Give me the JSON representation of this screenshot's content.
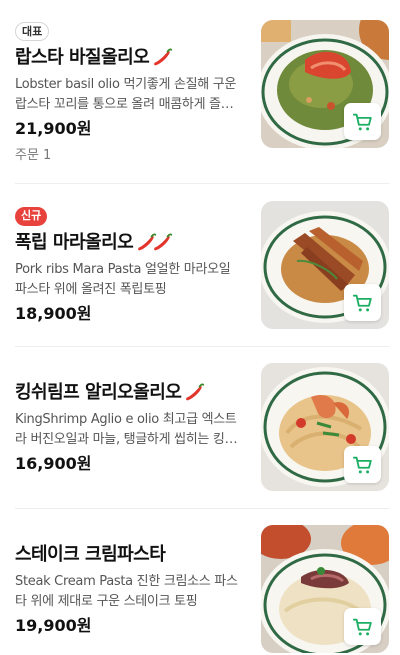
{
  "colors": {
    "accent_green": "#1cae62",
    "badge_red": "#e8423c",
    "text_main": "#111111",
    "text_sub": "#555555"
  },
  "menu_items": [
    {
      "badge": "대표",
      "title": "랍스타 바질올리오",
      "spicy": 1,
      "description": "Lobster basil olio 먹기좋게 손질해 구운 랍스타 꼬리를 통으로 올려 매콤하게 즐기는 바질 오일 파스타",
      "price": "21,900원",
      "orders": "주문 1",
      "cart_icon": "shopping-cart-icon"
    },
    {
      "badge": "신규",
      "title": "폭립 마라올리오",
      "spicy": 2,
      "description": "Pork ribs Mara Pasta 얼얼한 마라오일 파스타 위에 올려진 폭립토핑",
      "price": "18,900원",
      "cart_icon": "shopping-cart-icon"
    },
    {
      "title": "킹쉬림프 알리오올리오",
      "spicy": 1,
      "description": "KingShrimp Aglio e olio 최고급 엑스트라 버진오일과 마늘, 탱글하게 씹히는 킹쉬림프",
      "price": "16,900원",
      "cart_icon": "shopping-cart-icon"
    },
    {
      "title": "스테이크 크림파스타",
      "description": "Steak Cream Pasta 진한 크림소스 파스타 위에 제대로 구운 스테이크 토핑",
      "price": "19,900원",
      "cart_icon": "shopping-cart-icon"
    }
  ]
}
